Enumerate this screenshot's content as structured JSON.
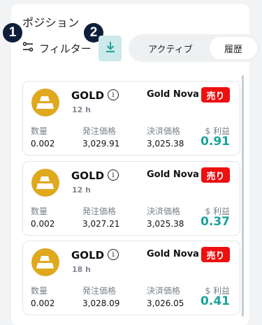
{
  "header": {
    "title": "ポジション",
    "filter_label": "フィルター",
    "badge_1": "1",
    "badge_2": "2",
    "tabs": [
      "アクティブ",
      "履歴"
    ],
    "accent_color": "#1aa39a"
  },
  "columns": {
    "qty": "数量",
    "open_price": "発注価格",
    "close_price": "決済価格",
    "pnl": "$ 利益"
  },
  "positions": [
    {
      "asset": "GOLD",
      "info": "i",
      "duration": "12 h",
      "provider": "Gold Nova",
      "side": "売り",
      "qty": "0.002",
      "open_price": "3,029.91",
      "close_price": "3,025.38",
      "pnl": "0.91"
    },
    {
      "asset": "GOLD",
      "info": "i",
      "duration": "12 h",
      "provider": "Gold Nova",
      "side": "売り",
      "qty": "0.002",
      "open_price": "3,027.21",
      "close_price": "3,025.38",
      "pnl": "0.37"
    },
    {
      "asset": "GOLD",
      "info": "i",
      "duration": "18 h",
      "provider": "Gold Nova",
      "side": "売り",
      "qty": "0.002",
      "open_price": "3,028.09",
      "close_price": "3,026.05",
      "pnl": "0.41"
    }
  ]
}
